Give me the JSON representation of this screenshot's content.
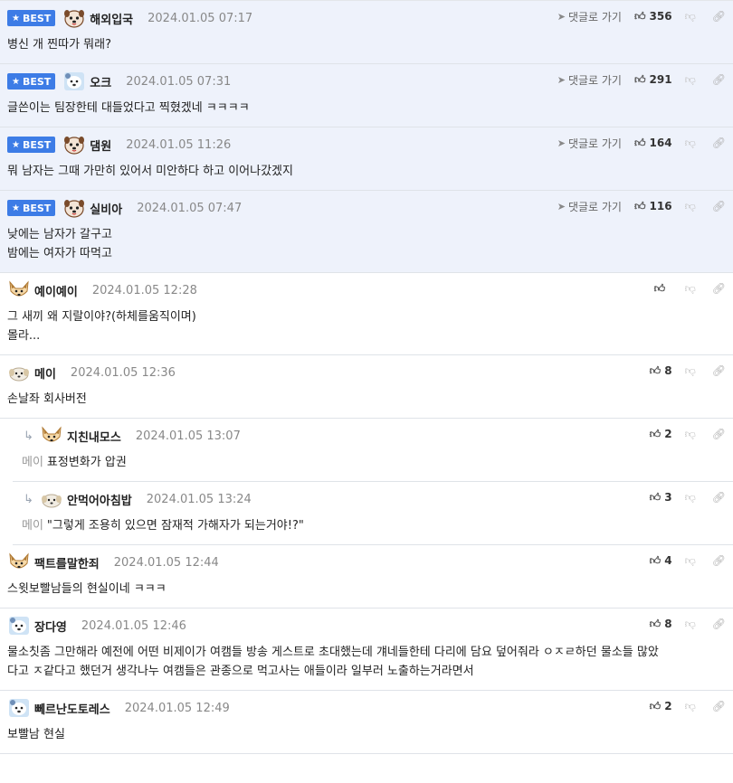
{
  "labels": {
    "best": "BEST",
    "goto_reply": "댓글로 가기"
  },
  "colors": {
    "best_badge": "#3d7ce6",
    "best_bg": "#eef2fb"
  },
  "comments": [
    {
      "best": true,
      "author": "해외입국",
      "date": "2024.01.05 07:17",
      "likes": "356",
      "avatar": "dog-face-icon",
      "lines": [
        "병신 개 찐따가 뭐래?"
      ]
    },
    {
      "best": true,
      "author": "오크",
      "date": "2024.01.05 07:31",
      "likes": "291",
      "avatar": "dog-blue-icon",
      "lines": [
        "글쓴이는 팀장한테 대들었다고 찍혔겠네 ㅋㅋㅋㅋ"
      ]
    },
    {
      "best": true,
      "author": "댐원",
      "date": "2024.01.05 11:26",
      "likes": "164",
      "avatar": "dog-face-icon",
      "lines": [
        "뭐 남자는 그때 가만히 있어서 미안하다 하고 이어나갔겠지"
      ]
    },
    {
      "best": true,
      "author": "실비아",
      "date": "2024.01.05 07:47",
      "likes": "116",
      "avatar": "dog-face-icon",
      "lines": [
        "낮에는 남자가 갈구고",
        "밤에는 여자가 따먹고"
      ]
    },
    {
      "best": false,
      "author": "예이예이",
      "date": "2024.01.05 12:28",
      "likes": "",
      "avatar": "fox-icon",
      "lines": [
        "그 새끼 왜 지랄이야?(하체를움직이며)",
        "몰라..."
      ]
    },
    {
      "best": false,
      "author": "메이",
      "date": "2024.01.05 12:36",
      "likes": "8",
      "avatar": "puppy-icon",
      "lines": [
        "손날좌 회사버전"
      ]
    },
    {
      "best": false,
      "reply": true,
      "author": "지친내모스",
      "date": "2024.01.05 13:07",
      "likes": "2",
      "avatar": "fox-icon",
      "mention": "메이",
      "lines": [
        "표정변화가 압권"
      ]
    },
    {
      "best": false,
      "reply": true,
      "author": "안먹어아침밥",
      "date": "2024.01.05 13:24",
      "likes": "3",
      "avatar": "puppy-icon",
      "mention": "메이",
      "lines": [
        "\"그렇게 조용히 있으면 잠재적 가해자가 되는거야!?\""
      ]
    },
    {
      "best": false,
      "author": "팩트를말한죄",
      "date": "2024.01.05 12:44",
      "likes": "4",
      "avatar": "fox-icon",
      "lines": [
        "스윗보빨남들의 현실이네 ㅋㅋㅋ"
      ]
    },
    {
      "best": false,
      "author": "장다영",
      "date": "2024.01.05 12:46",
      "likes": "8",
      "avatar": "dog-blue-icon",
      "lines": [
        "물소칫좀 그만해라 예전에 어떤 비제이가 여캠들 방송 게스트로 초대했는데 걔네들한테 다리에 담요 덮어줘라 ㅇㅈㄹ하던 물소들 많았",
        "다고 ㅈ같다고 했던거 생각나누 여캠들은 관종으로 먹고사는 애들이라 일부러 노출하는거라면서"
      ]
    },
    {
      "best": false,
      "author": "뻬르난도토레스",
      "date": "2024.01.05 12:49",
      "likes": "2",
      "avatar": "dog-blue-icon",
      "lines": [
        "보빨남 현실"
      ]
    }
  ]
}
